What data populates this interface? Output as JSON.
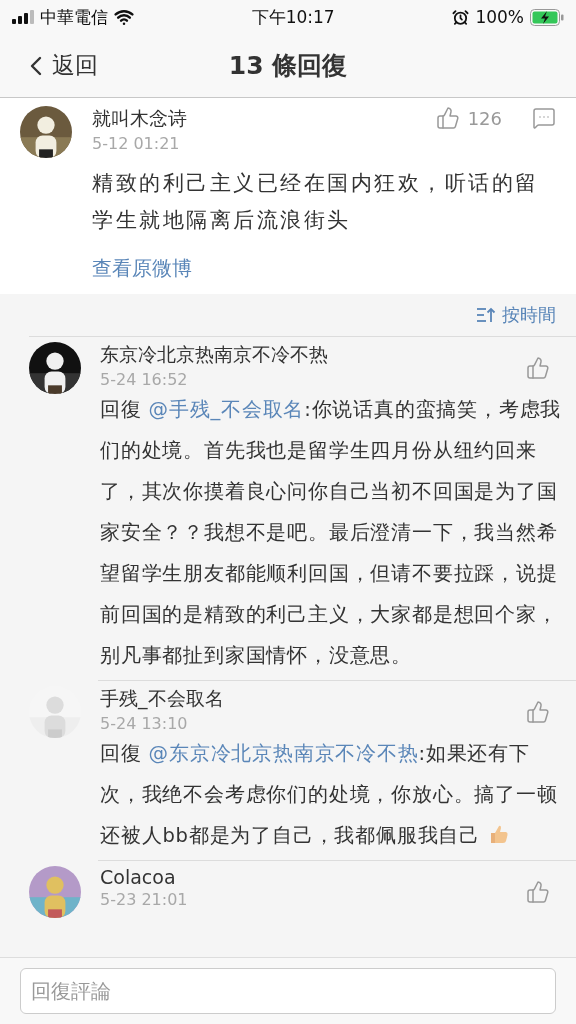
{
  "status_bar": {
    "carrier": "中華電信",
    "time": "下午10:17",
    "battery": "100%"
  },
  "nav": {
    "back": "返回",
    "title": "13 條回復"
  },
  "post": {
    "author": "就叫木念诗",
    "time": "5-12 01:21",
    "likes": "126",
    "text": "精致的利己主义已经在国内狂欢，听话的留学生就地隔离后流浪街头",
    "link": "查看原微博"
  },
  "sort": {
    "label": "按時間"
  },
  "replies": [
    {
      "author": "东京冷北京热南京不冷不热",
      "time": "5-24 16:52",
      "prefix": "回復",
      "mention": "@手残_不会取名",
      "text": ":你说话真的蛮搞笑，考虑我们的处境。首先我也是留学生四月份从纽约回来了，其次你摸着良心问你自己当初不回国是为了国家安全？？我想不是吧。最后澄清一下，我当然希望留学生朋友都能顺利回国，但请不要拉踩，说提前回国的是精致的利己主义，大家都是想回个家，别凡事都扯到家国情怀，没意思。",
      "emoji": false
    },
    {
      "author": "手残_不会取名",
      "time": "5-24 13:10",
      "prefix": "回復",
      "mention": "@东京冷北京热南京不冷不热",
      "text": ":如果还有下次，我绝不会考虑你们的处境，你放心。搞了一顿还被人bb都是为了自己，我都佩服我自己",
      "emoji": true
    },
    {
      "author": "Colacoa",
      "time": "5-23 21:01"
    }
  ],
  "reply_field": {
    "placeholder": "回復評論"
  }
}
